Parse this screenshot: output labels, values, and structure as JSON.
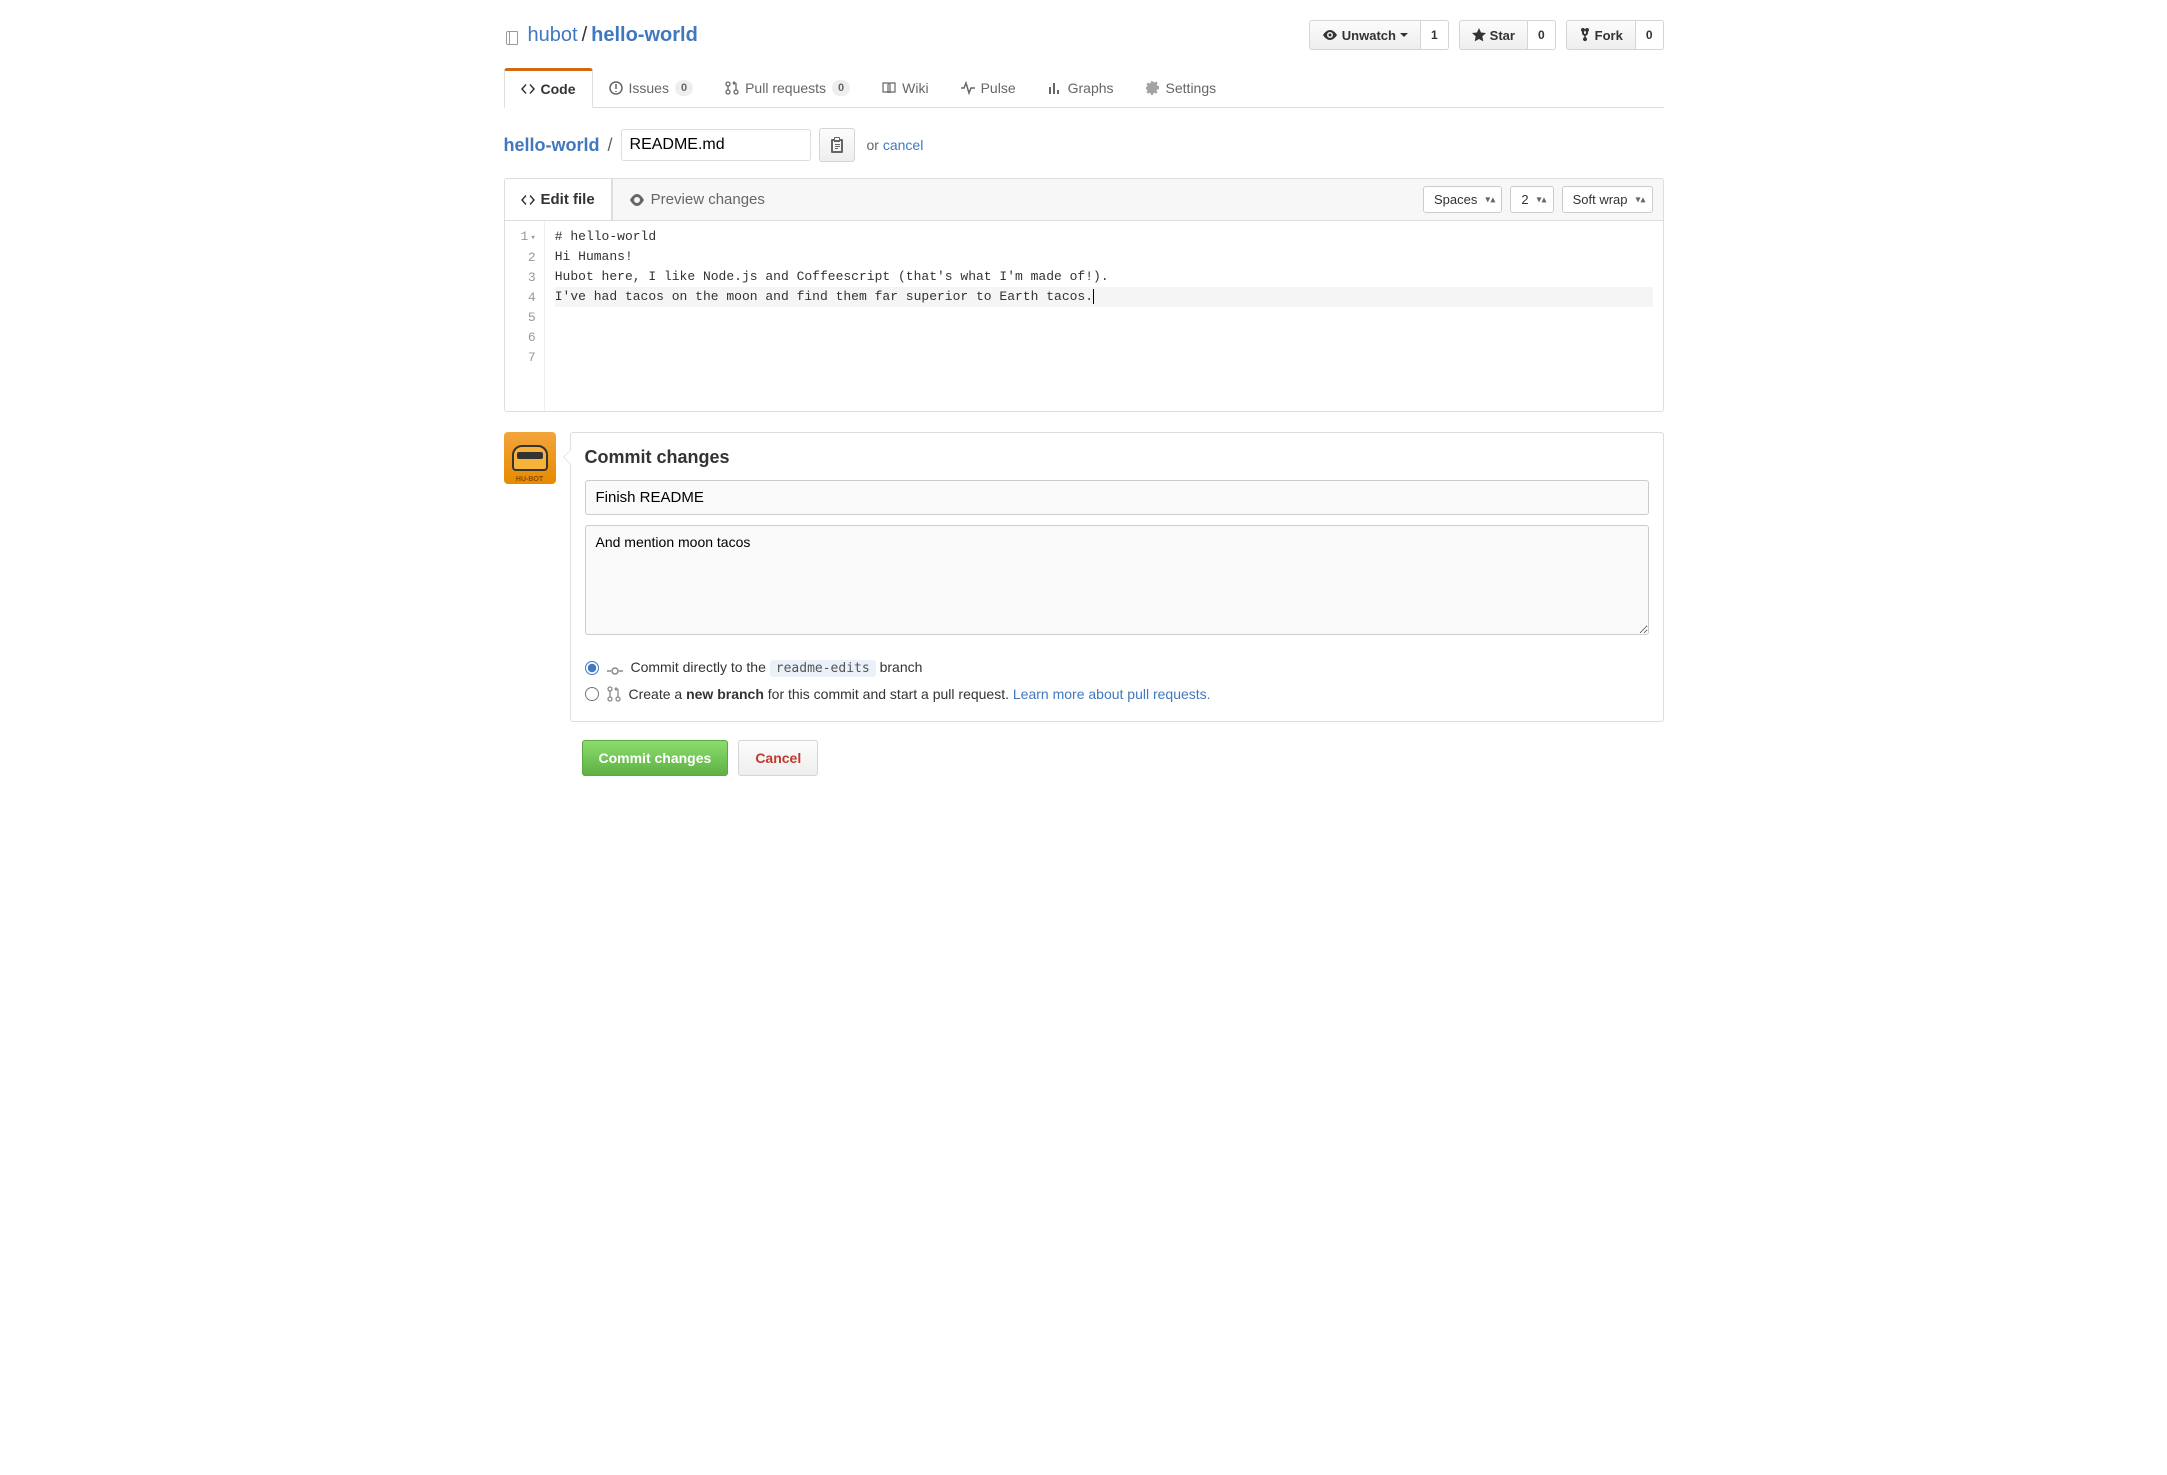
{
  "repo": {
    "owner": "hubot",
    "name": "hello-world",
    "sep": "/"
  },
  "actions": {
    "watch": {
      "label": "Unwatch",
      "count": "1"
    },
    "star": {
      "label": "Star",
      "count": "0"
    },
    "fork": {
      "label": "Fork",
      "count": "0"
    }
  },
  "tabs": {
    "code": "Code",
    "issues": {
      "label": "Issues",
      "count": "0"
    },
    "pulls": {
      "label": "Pull requests",
      "count": "0"
    },
    "wiki": "Wiki",
    "pulse": "Pulse",
    "graphs": "Graphs",
    "settings": "Settings"
  },
  "breadcrumb": {
    "repo": "hello-world",
    "sep": "/",
    "filename": "README.md",
    "or": "or",
    "cancel": "cancel"
  },
  "editor": {
    "tabs": {
      "edit": "Edit file",
      "preview": "Preview changes"
    },
    "indent_mode": "Spaces",
    "indent_size": "2",
    "wrap_mode": "Soft wrap",
    "lines": [
      "# hello-world",
      "",
      "Hi Humans!",
      "",
      "Hubot here, I like Node.js and Coffeescript (that's what I'm made of!).",
      "I've had tacos on the moon and find them far superior to Earth tacos.",
      ""
    ]
  },
  "avatar": {
    "label": "HU-BOT"
  },
  "commit": {
    "heading": "Commit changes",
    "summary": "Finish README",
    "description": "And mention moon tacos",
    "option_direct_pre": "Commit directly to the",
    "option_direct_branch": "readme-edits",
    "option_direct_post": "branch",
    "option_newbranch_pre": "Create a",
    "option_newbranch_bold": "new branch",
    "option_newbranch_post": "for this commit and start a pull request.",
    "learn_more": "Learn more about pull requests."
  },
  "buttons": {
    "commit": "Commit changes",
    "cancel": "Cancel"
  }
}
